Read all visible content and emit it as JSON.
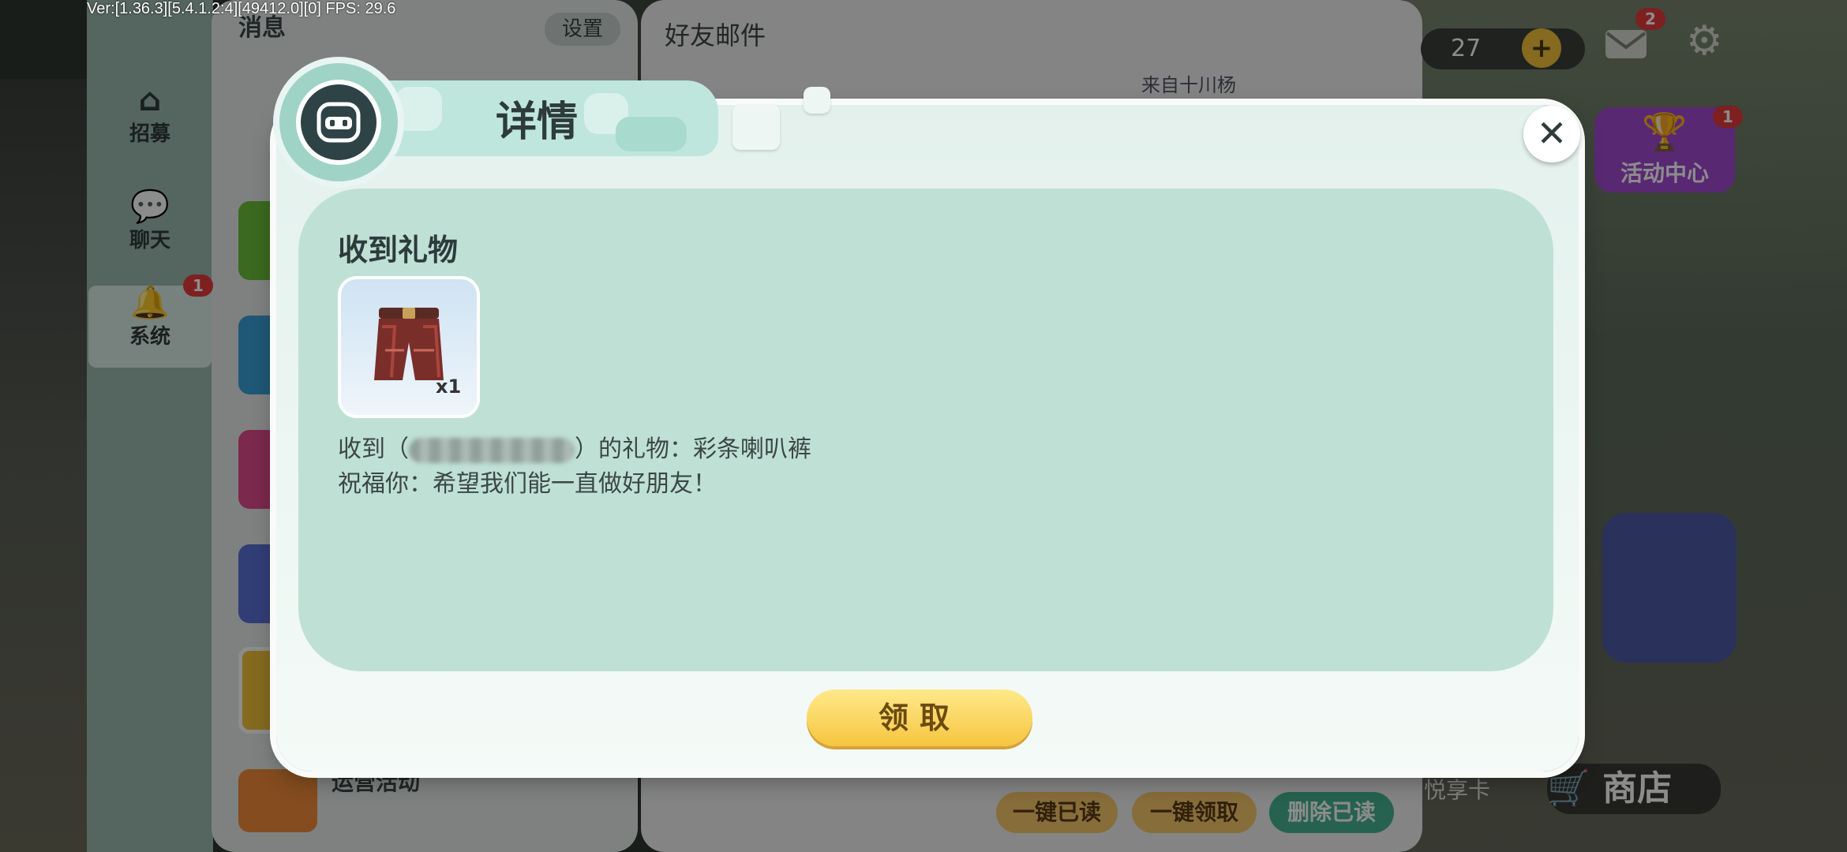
{
  "debug_text": "Ver:[1.36.3][5.4.1.2:4][49412.0][0] FPS: 29.6",
  "left_nav": {
    "items": [
      {
        "label": "招募",
        "icon": "house-icon"
      },
      {
        "label": "聊天",
        "icon": "chat-bubble-icon"
      },
      {
        "label": "系统",
        "icon": "bell-icon",
        "badge": "1"
      }
    ]
  },
  "messages": {
    "title": "消息",
    "settings_label": "设置",
    "ops_activity_label": "运营活动"
  },
  "mail": {
    "title": "好友邮件",
    "from_text": "来自十川杨",
    "buttons": {
      "mark_all_read": "一键已读",
      "claim_all": "一键领取",
      "delete_read": "删除已读"
    }
  },
  "hud": {
    "currency": "27",
    "mail_badge": "2",
    "activity_center": "活动中心",
    "activity_badge": "1",
    "yuexiang_card": "悦享卡",
    "shop": "商店"
  },
  "modal": {
    "title": "详情",
    "section_title": "收到礼物",
    "item_count": "x1",
    "gift_line_prefix": "收到（",
    "gift_line_suffix": "）的礼物：彩条喇叭裤",
    "blessing": "祝福你：希望我们能一直做好朋友！",
    "claim_label": "领取"
  },
  "colors": {
    "modal_bg": "#e3f1ed",
    "content_bg": "#bfe0d5",
    "accent_yellow": "#f6c53f",
    "delete_green": "#45b390"
  }
}
